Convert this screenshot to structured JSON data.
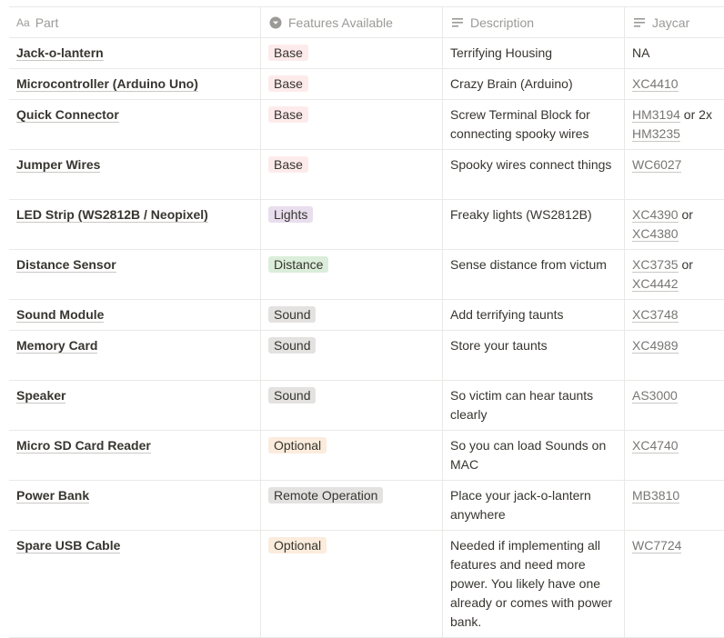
{
  "headers": {
    "part": "Part",
    "part_icon_text": "Aa",
    "features": "Features Available",
    "description": "Description",
    "jaycar": "Jaycar"
  },
  "tag_colors": {
    "Base": "#fdebec",
    "Lights": "#e8deee",
    "Distance": "#dbeddb",
    "Sound": "#e3e2e0",
    "Optional": "#fbecdd",
    "Remote Operation": "#e3e2e0"
  },
  "rows": [
    {
      "part": "Jack-o-lantern",
      "feature": "Base",
      "description": "Terrifying Housing",
      "jaycar": [
        {
          "text": "NA",
          "link": false
        }
      ],
      "height": 33
    },
    {
      "part": "Microcontroller (Arduino Uno)",
      "feature": "Base",
      "description": "Crazy Brain (Arduino)",
      "jaycar": [
        {
          "text": "XC4410",
          "link": true
        }
      ],
      "height": 33
    },
    {
      "part": "Quick Connector",
      "feature": "Base",
      "description": "Screw Terminal Block for connecting spooky wires",
      "jaycar": [
        {
          "text": "HM3194",
          "link": true
        },
        {
          "text": " or ",
          "link": false
        },
        {
          "text": "2x ",
          "link": false
        },
        {
          "text": "HM3235",
          "link": true
        }
      ],
      "height": 54
    },
    {
      "part": "Jumper Wires",
      "feature": "Base",
      "description": "Spooky wires connect things",
      "jaycar": [
        {
          "text": "WC6027",
          "link": true
        }
      ],
      "height": 54
    },
    {
      "part": "LED Strip (WS2812B / Neopixel)",
      "feature": "Lights",
      "description": "Freaky lights (WS2812B)",
      "jaycar": [
        {
          "text": "XC4390",
          "link": true
        },
        {
          "text": " or ",
          "link": false
        },
        {
          "text": "XC4380",
          "link": true
        }
      ],
      "height": 54
    },
    {
      "part": "Distance Sensor",
      "feature": "Distance",
      "description": "Sense distance from victum",
      "jaycar": [
        {
          "text": "XC3735",
          "link": true
        },
        {
          "text": " or ",
          "link": false
        },
        {
          "text": "XC4442",
          "link": true
        }
      ],
      "height": 54
    },
    {
      "part": "Sound Module",
      "feature": "Sound",
      "description": "Add terrifying taunts",
      "jaycar": [
        {
          "text": "XC3748",
          "link": true
        }
      ],
      "height": 33
    },
    {
      "part": "Memory Card",
      "feature": "Sound",
      "description": "Store your taunts",
      "jaycar": [
        {
          "text": "XC4989",
          "link": true
        }
      ],
      "height": 54
    },
    {
      "part": "Speaker",
      "feature": "Sound",
      "description": "So victim can hear taunts clearly",
      "jaycar": [
        {
          "text": "AS3000",
          "link": true
        }
      ],
      "height": 54
    },
    {
      "part": "Micro SD Card Reader",
      "feature": "Optional",
      "description": "So you can load Sounds on MAC",
      "jaycar": [
        {
          "text": "XC4740",
          "link": true
        }
      ],
      "height": 54
    },
    {
      "part": "Power Bank",
      "feature": "Remote Operation",
      "description": "Place your jack-o-lantern anywhere",
      "jaycar": [
        {
          "text": "MB3810",
          "link": true
        }
      ],
      "height": 54
    },
    {
      "part": "Spare USB Cable",
      "feature": "Optional",
      "description": "Needed if implementing all features and need more power. You likely have one already or comes with power bank.",
      "jaycar": [
        {
          "text": "WC7724",
          "link": true
        }
      ],
      "height": 117
    }
  ]
}
